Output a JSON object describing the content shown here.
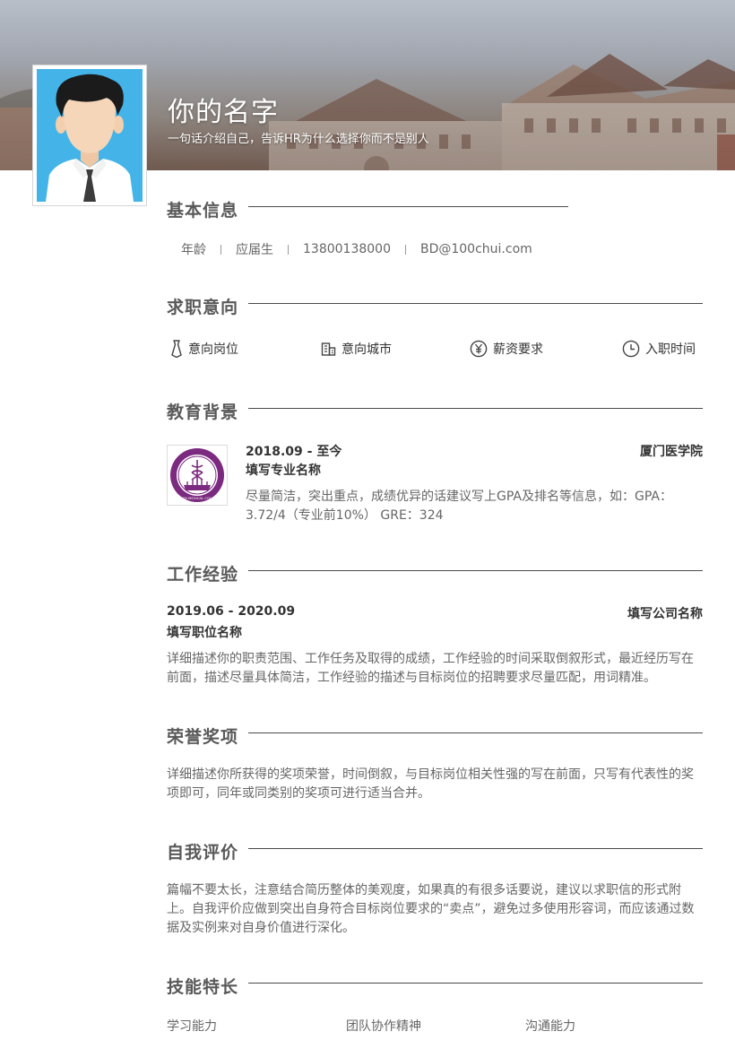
{
  "header": {
    "name": "你的名字",
    "tagline": "一句话介绍自己，告诉HR为什么选择你而不是别人"
  },
  "basic_info": {
    "title": "基本信息",
    "items": [
      "年龄",
      "应届生",
      "13800138000",
      "BD@100chui.com"
    ]
  },
  "job_intention": {
    "title": "求职意向",
    "items": [
      {
        "label": "意向岗位",
        "icon": "tie-icon"
      },
      {
        "label": "意向城市",
        "icon": "building-icon"
      },
      {
        "label": "薪资要求",
        "icon": "yen-icon"
      },
      {
        "label": "入职时间",
        "icon": "clock-icon"
      }
    ]
  },
  "education": {
    "title": "教育背景",
    "period": "2018.09 - 至今",
    "school": "厦门医学院",
    "major": "填写专业名称",
    "description": "尽量简洁，突出重点，成绩优异的话建议写上GPA及排名等信息，如：GPA：3.72/4（专业前10%） GRE：324",
    "logo_text": "XIAMEN MEDICAL COLLEGE"
  },
  "work": {
    "title": "工作经验",
    "period": "2019.06 - 2020.09",
    "company": "填写公司名称",
    "position": "填写职位名称",
    "description": "详细描述你的职责范围、工作任务及取得的成绩，工作经验的时间采取倒叙形式，最近经历写在前面，描述尽量具体简洁，工作经验的描述与目标岗位的招聘要求尽量匹配，用词精准。"
  },
  "honors": {
    "title": "荣誉奖项",
    "description": "详细描述你所获得的奖项荣誉，时间倒叙，与目标岗位相关性强的写在前面，只写有代表性的奖项即可，同年或同类别的奖项可进行适当合并。"
  },
  "self_evaluation": {
    "title": "自我评价",
    "description": "篇幅不要太长，注意结合简历整体的美观度，如果真的有很多话要说，建议以求职信的形式附上。自我评价应做到突出自身符合目标岗位要求的“卖点”，避免过多使用形容词，而应该通过数据及实例来对自身价值进行深化。"
  },
  "skills": {
    "title": "技能特长",
    "items": [
      "学习能力",
      "团队协作精神",
      "沟通能力"
    ]
  },
  "colors": {
    "text_dark": "#333333",
    "text_muted": "#666666",
    "heading": "#595959",
    "avatar_bg": "#44b4e8",
    "logo_purple": "#7b2a7f"
  }
}
